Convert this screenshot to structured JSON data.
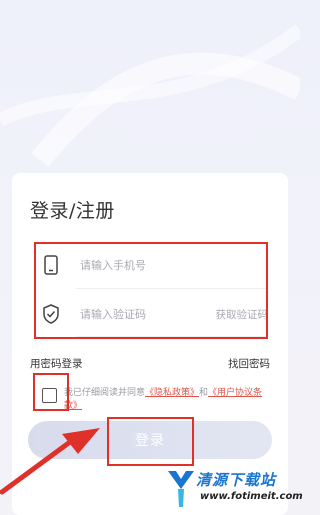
{
  "header": {
    "title": "登录/注册"
  },
  "phone_field": {
    "placeholder": "请输入手机号",
    "icon": "phone-icon"
  },
  "code_field": {
    "placeholder": "请输入验证码",
    "icon": "shield-check-icon",
    "get_code_label": "获取验证码"
  },
  "options": {
    "password_login": "用密码登录",
    "find_password": "找回密码"
  },
  "agreement": {
    "checked": false,
    "prefix": "我已仔细阅读并同意",
    "privacy_link": "《隐私政策》",
    "and": "和",
    "terms_link": "《用户协议条款》"
  },
  "login_button": {
    "label": "登录"
  },
  "watermark": {
    "title": "清源下载站",
    "url": "www.fotimeit.com"
  },
  "colors": {
    "annotation_red": "#e0302a",
    "link_red": "#e1564a",
    "button_bg": "#dde0ef"
  }
}
